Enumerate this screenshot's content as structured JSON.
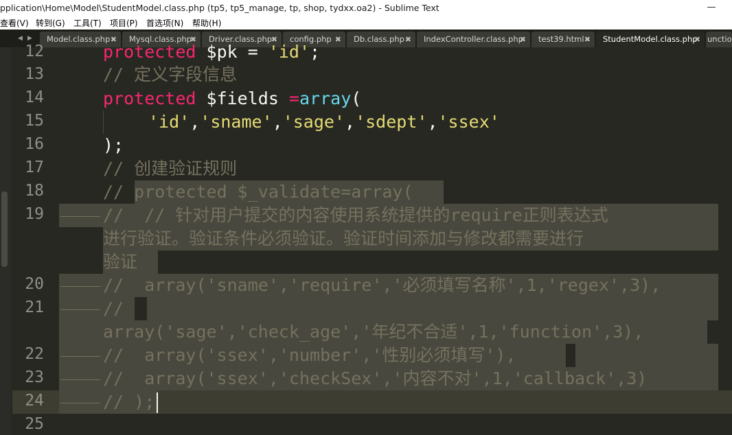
{
  "window": {
    "title": "pplication\\Home\\Model\\StudentModel.class.php (tp5, tp5_manage, tp, shop, tydxx.oa2) - Sublime Text"
  },
  "menu": [
    {
      "label": "查看(V)"
    },
    {
      "label": "转到(G)"
    },
    {
      "label": "工具(T)"
    },
    {
      "label": "项目(P)"
    },
    {
      "label": "首选项(N)"
    },
    {
      "label": "帮助(H)"
    }
  ],
  "tab_nav": {
    "left": "◀",
    "right": "▶"
  },
  "tabs": [
    {
      "label": "Model.class.php",
      "close": "✖"
    },
    {
      "label": "Mysql.class.php",
      "close": "✖"
    },
    {
      "label": "Driver.class.php",
      "close": "✖"
    },
    {
      "label": "config.php",
      "close": "✖"
    },
    {
      "label": "Db.class.php",
      "close": "✖"
    },
    {
      "label": "IndexController.class.php",
      "close": "✖"
    },
    {
      "label": "test39.html",
      "close": "✖"
    },
    {
      "label": "StudentModel.class.php",
      "close": "✖",
      "active": true
    },
    {
      "label": "unction",
      "close": ""
    }
  ],
  "lines": {
    "n12": "12",
    "n13": "13",
    "n14": "14",
    "n15": "15",
    "n16": "16",
    "n17": "17",
    "n18": "18",
    "n19": "19",
    "n20": "20",
    "n21": "21",
    "n22": "22",
    "n23": "23",
    "n24": "24",
    "n25": "25"
  },
  "code": {
    "l12_kw": "protected",
    "l12_rest": " $pk = ",
    "l12_str": "'id'",
    "l12_end": ";",
    "l13": "// 定义字段信息",
    "l14_kw": "protected",
    "l14_var": " $fields ",
    "l14_eq": "=",
    "l14_fn": "array",
    "l14_paren": "(",
    "l15_s1": "'id'",
    "l15_s2": "'sname'",
    "l15_s3": "'sage'",
    "l15_s4": "'sdept'",
    "l15_s5": "'ssex'",
    "l15_comma": ",",
    "l16": ");",
    "l17": "// 创建验证规则",
    "l18": "// protected $_validate=array(",
    "l19a": "//  // 针对用户提交的内容使用系统提供的require正则表达式",
    "l19b": "进行验证。验证条件必须验证。验证时间添加与修改都需要进行",
    "l19c": "验证",
    "l20": "//  array('sname','require','必须填写名称',1,'regex',3),",
    "l21a": "//",
    "l21b": "array('sage','check_age','年纪不合适',1,'function',3),",
    "l22": "//  array('ssex','number','性别必须填写'),",
    "l23": "//  array('ssex','checkSex','内容不对',1,'callback',3)",
    "l24": "// );"
  },
  "colors": {
    "background": "#272822",
    "keyword": "#f92672",
    "string": "#e6db74",
    "function": "#66d9ef",
    "comment": "#75715e",
    "selection": "#49483e",
    "line_number": "#8f908a"
  }
}
